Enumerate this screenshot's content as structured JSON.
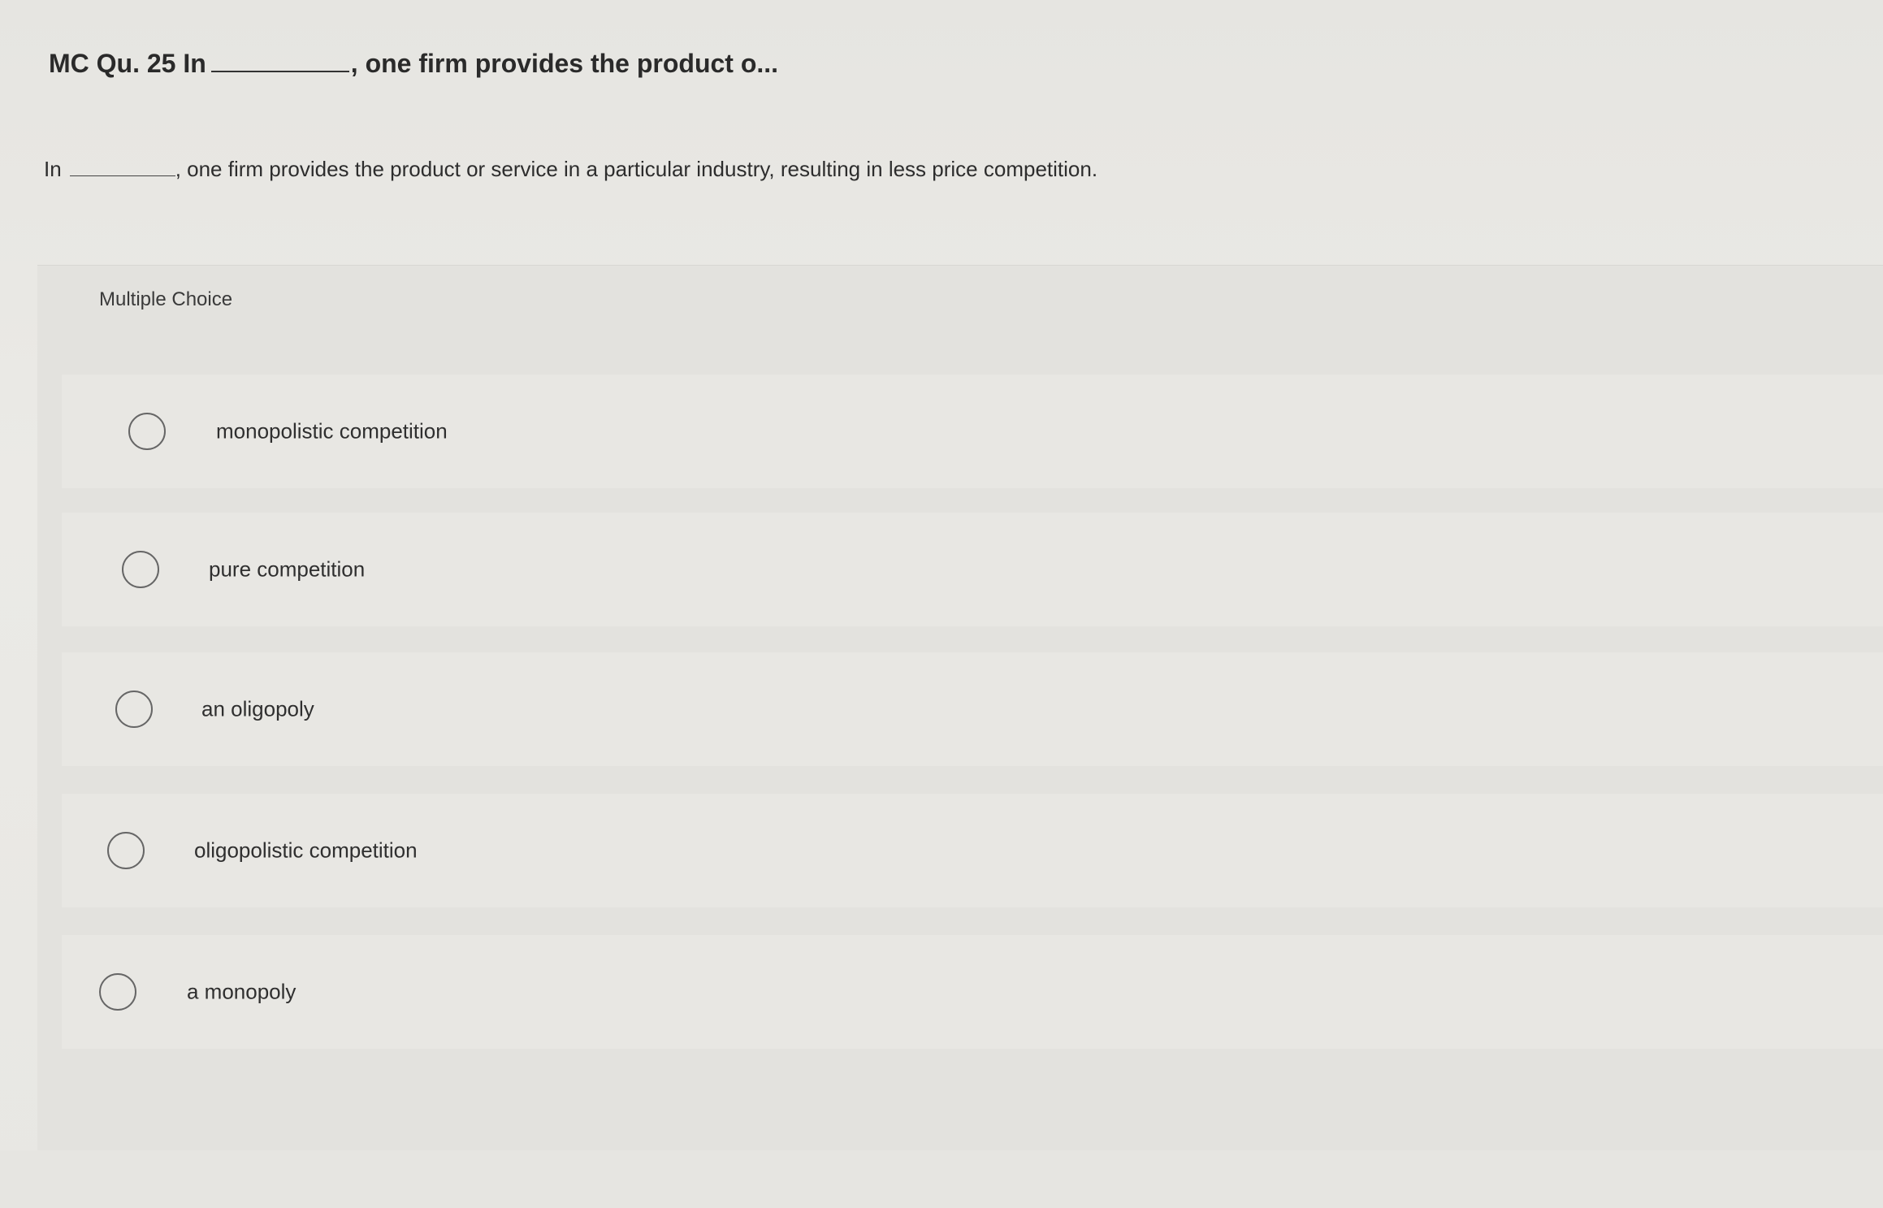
{
  "question": {
    "title_prefix": "MC Qu. 25 In",
    "title_suffix": ", one firm provides the product o...",
    "prompt_prefix": "In",
    "prompt_suffix": ", one firm provides the product or service in a particular industry, resulting in less price competition."
  },
  "multiple_choice": {
    "label": "Multiple Choice",
    "options": [
      {
        "label": "monopolistic competition",
        "selected": false
      },
      {
        "label": "pure competition",
        "selected": false
      },
      {
        "label": "an oligopoly",
        "selected": false
      },
      {
        "label": "oligopolistic competition",
        "selected": false
      },
      {
        "label": "a monopoly",
        "selected": false
      }
    ]
  }
}
